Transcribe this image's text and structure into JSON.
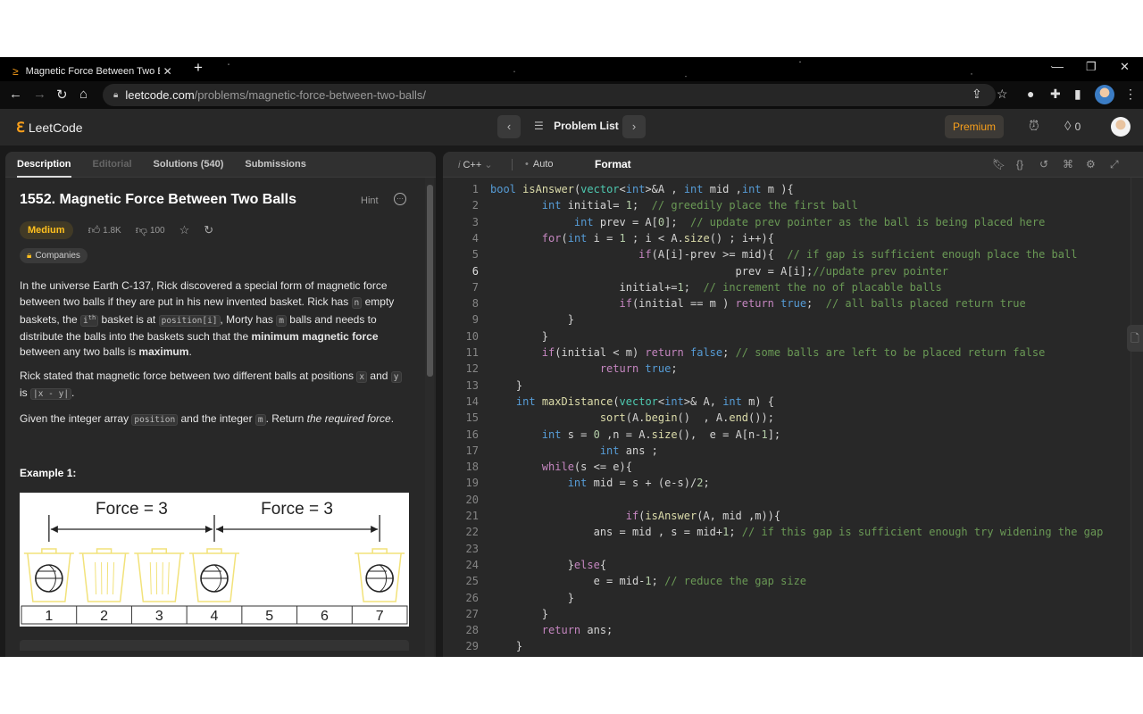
{
  "browser": {
    "tab_title": "Magnetic Force Between Two Balls",
    "tab_title_visible": "Magnetic Force Between Two Bal",
    "url_host": "leetcode.com",
    "url_path": "/problems/magnetic-force-between-two-balls/",
    "icons": [
      "back-icon",
      "forward-icon",
      "reload-icon",
      "home-icon",
      "lock-icon",
      "share-icon",
      "star-icon",
      "extension-icon",
      "puzzle-icon",
      "sidebar-icon",
      "profile-icon",
      "menu-icon"
    ]
  },
  "nav": {
    "brand": "LeetCode",
    "problem_list": "Problem List",
    "premium": "Premium",
    "streak_count": "0"
  },
  "left": {
    "tabs": [
      {
        "label": "Description",
        "state": "active"
      },
      {
        "label": "Editorial",
        "state": "disabled"
      },
      {
        "label": "Solutions (540)",
        "state": "normal"
      },
      {
        "label": "Submissions",
        "state": "normal"
      }
    ],
    "title": "1552. Magnetic Force Between Two Balls",
    "hint": "Hint",
    "difficulty": "Medium",
    "likes": "1.8K",
    "dislikes": "100",
    "companies": "Companies",
    "p1": {
      "a": "In the universe Earth C-137, Rick discovered a special form of magnetic force between two balls if they are put in his new invented basket. Rick has ",
      "code_n": "n",
      "b": " empty baskets, the ",
      "code_i": "i",
      "sup": "th",
      "c": " basket is at ",
      "code_pos": "position[i]",
      "d": ", Morty has ",
      "code_m": "m",
      "e": " balls and needs to distribute the balls into the baskets such that the ",
      "bold1": "minimum magnetic force",
      "f": " between any two balls is ",
      "bold2": "maximum",
      "g": "."
    },
    "p2": {
      "a": "Rick stated that magnetic force between two different balls at positions ",
      "code_x": "x",
      "b": " and ",
      "code_y": "y",
      "c": " is ",
      "code_abs": "|x - y|",
      "d": "."
    },
    "p3": {
      "a": "Given the integer array ",
      "code_pos": "position",
      "b": " and the integer ",
      "code_m": "m",
      "c": ". Return ",
      "italic": "the required force",
      "d": "."
    },
    "example_heading": "Example 1:",
    "figure": {
      "labels": [
        "Force = 3",
        "Force = 3"
      ],
      "positions": [
        "1",
        "2",
        "3",
        "4",
        "5",
        "6",
        "7"
      ],
      "balls_at": [
        1,
        4,
        7
      ],
      "baskets_at": [
        1,
        2,
        3,
        4,
        7
      ]
    }
  },
  "editor": {
    "language": "C++",
    "mode": "Auto",
    "format": "Format",
    "current_line": 6,
    "lines": [
      "bool isAnswer(vector<int>&A , int mid ,int m ){",
      "        int initial= 1;  // greedily place the first ball",
      "             int prev = A[0];  // update prev pointer as the ball is being placed here",
      "        for(int i = 1 ; i < A.size() ; i++){",
      "                       if(A[i]-prev >= mid){  // if gap is sufficient enough place the ball",
      "                                      prev = A[i];//update prev pointer",
      "                    initial+=1;  // increment the no of placable balls",
      "                    if(initial == m ) return true;  // all balls placed return true",
      "            }",
      "        }",
      "        if(initial < m) return false; // some balls are left to be placed return false",
      "                 return true;",
      "    }",
      "    int maxDistance(vector<int>& A, int m) {",
      "                 sort(A.begin()  , A.end());",
      "        int s = 0 ,n = A.size(),  e = A[n-1];",
      "                 int ans ;",
      "        while(s <= e){",
      "            int mid = s + (e-s)/2;",
      "",
      "                     if(isAnswer(A, mid ,m)){",
      "                ans = mid , s = mid+1; // if this gap is sufficient enough try widening the gap",
      "",
      "            }else{",
      "                e = mid-1; // reduce the gap size",
      "            }",
      "        }",
      "        return ans;",
      "    }"
    ]
  },
  "colors": {
    "accent": "#f89f1b",
    "medium": "#ffc01e",
    "keyword": "#569cd6",
    "control": "#c586c0",
    "function": "#dcdcaa",
    "comment": "#6a9955",
    "basket": "#f2e27a"
  }
}
